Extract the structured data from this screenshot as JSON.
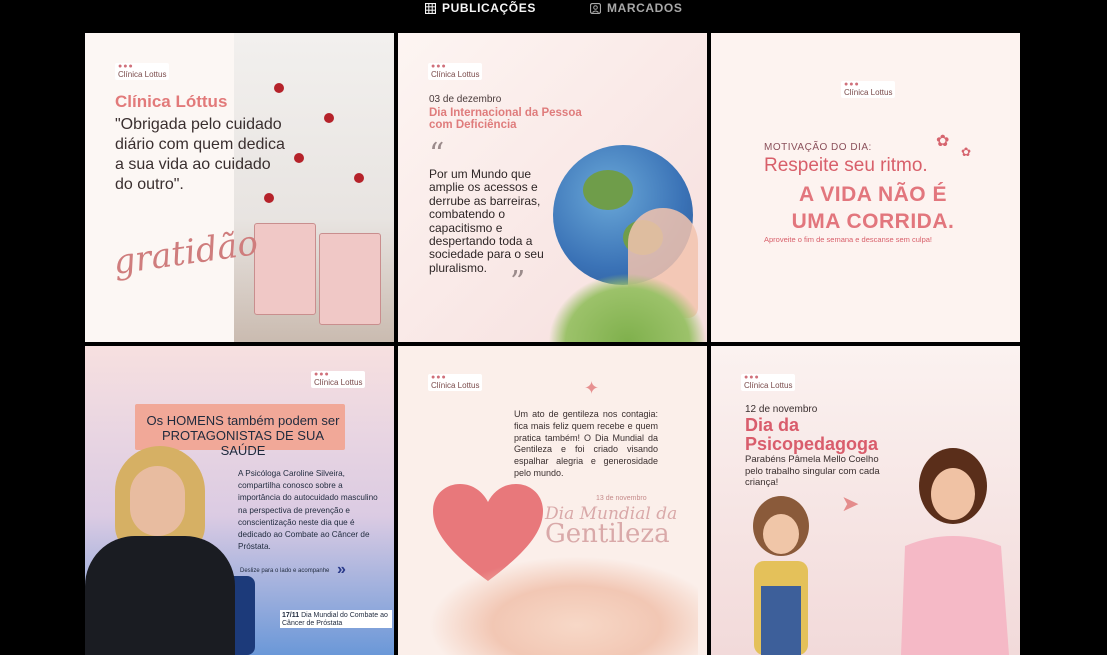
{
  "tabs": {
    "publicacoes": "PUBLICAÇÕES",
    "marcados": "MARCADOS"
  },
  "brand": {
    "name": "Clínica Lottus",
    "dots": "●●●"
  },
  "posts": {
    "p1": {
      "heading": "Clínica Lóttus",
      "quote": "\"Obrigada pelo cuidado diário com quem dedica a sua vida ao cuidado do outro\".",
      "signature": "gratidão"
    },
    "p2": {
      "date": "03 de dezembro",
      "title": "Dia Internacional da Pessoa com Deficiência",
      "body": "Por um Mundo que amplie os acessos e derrube as barreiras, combatendo o capacitismo e despertando toda a sociedade para o seu pluralismo.",
      "open_quote": "“",
      "close_quote": "”"
    },
    "p3": {
      "motivation": "MOTIVAÇÃO DO DIA:",
      "respect": "Respeite seu ritmo.",
      "big": "A VIDA NÃO É UMA CORRIDA.",
      "sub": "Aproveite o fim de semana e descanse sem culpa!"
    },
    "p4": {
      "headline": "Os HOMENS também podem ser PROTAGONISTAS DE SUA SAÚDE",
      "body": "A Psicóloga Caroline Silveira, compartilha conosco sobre a importância do autocuidado masculino na perspectiva de prevenção e conscientização neste dia que é dedicado ao Combate ao Câncer de Próstata.",
      "swipe": "Deslize para o lado e acompanhe",
      "arrow": "»",
      "badge_date": "17/11",
      "badge_text": "Dia Mundial do Combate ao Câncer de Próstata"
    },
    "p5": {
      "body": "Um ato de gentileza nos contagia: fica mais feliz quem recebe e quem pratica também! O Dia Mundial da Gentileza e foi criado visando espalhar alegria e generosidade pelo mundo.",
      "date": "13 de novembro",
      "dm": "Dia Mundial da",
      "gentileza": "Gentileza"
    },
    "p6": {
      "date": "12 de novembro",
      "title": "Dia da Psicopedagoga",
      "body": "Parabéns Pâmela Mello Coelho pelo trabalho singular com cada criança!"
    }
  },
  "colors": {
    "accent_pink": "#e27a7a",
    "dark_bg": "#000000",
    "active_tab": "#f5f5f5",
    "inactive_tab": "#a8a8a8"
  }
}
